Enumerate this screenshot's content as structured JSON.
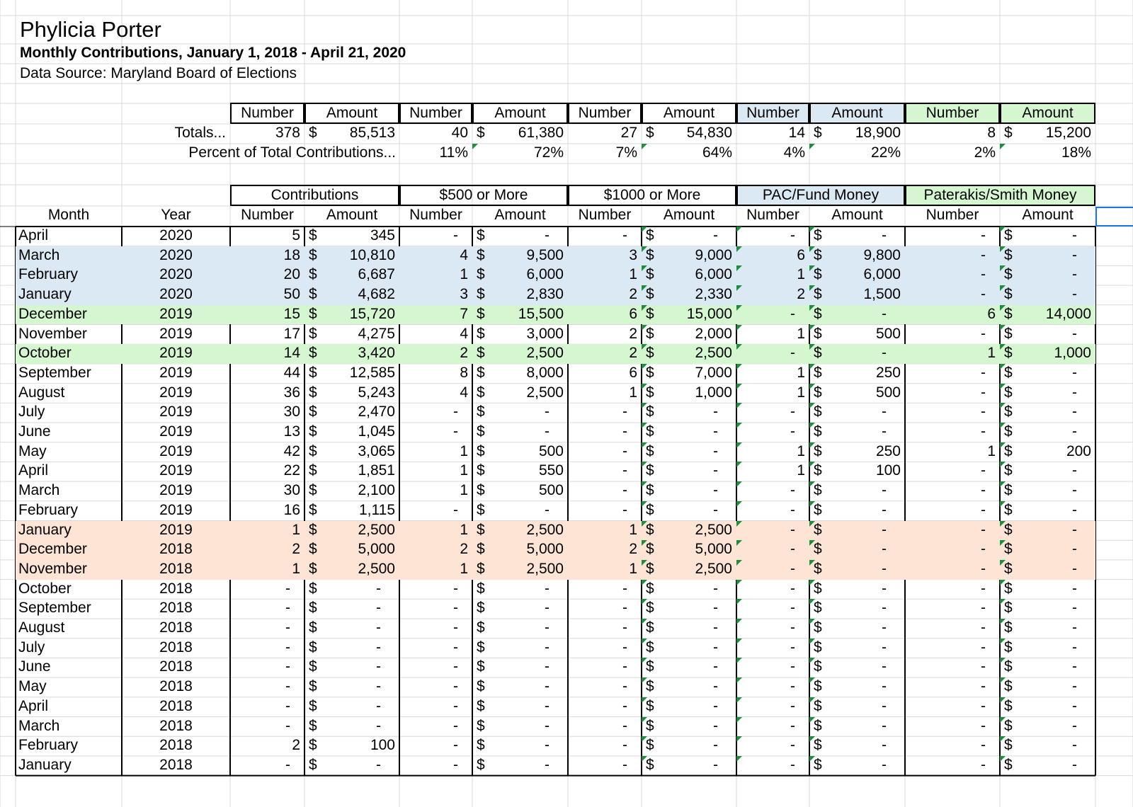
{
  "header": {
    "name": "Phylicia Porter",
    "subtitle": "Monthly Contributions, January 1, 2018 - April 21, 2020",
    "source": "Data Source:  Maryland Board of Elections"
  },
  "colors": {
    "blue": "#dbe9f4",
    "green": "#d4f7d0",
    "peach": "#fde4d4",
    "grid": "#d9d9d9",
    "comment": "#1e8e3e",
    "selection": "#1a73e8"
  },
  "labels": {
    "number": "Number",
    "amount": "Amount",
    "totals": "Totals...",
    "percent": "Percent of Total Contributions...",
    "month": "Month",
    "year": "Year",
    "currency": "$",
    "dash": "-"
  },
  "groups": [
    "Contributions",
    "$500 or More",
    "$1000 or More",
    "PAC/Fund Money",
    "Paterakis/Smith Money"
  ],
  "totals": [
    {
      "number": "378",
      "amount": "85,513"
    },
    {
      "number": "40",
      "amount": "61,380"
    },
    {
      "number": "27",
      "amount": "54,830"
    },
    {
      "number": "14",
      "amount": "18,900"
    },
    {
      "number": "8",
      "amount": "15,200"
    }
  ],
  "percents": [
    {
      "number": "11%",
      "amount": ""
    },
    {
      "number": "",
      "amount": "72%"
    },
    {
      "number": "7%",
      "amount": ""
    },
    {
      "number": "",
      "amount": "64%"
    },
    {
      "number": "4%",
      "amount": ""
    },
    {
      "number": "",
      "amount": "22%"
    },
    {
      "number": "2%",
      "amount": ""
    },
    {
      "number": "",
      "amount": "18%"
    }
  ],
  "percent_values": [
    "11%",
    "72%",
    "7%",
    "64%",
    "4%",
    "22%",
    "2%",
    "18%"
  ],
  "rows": [
    {
      "month": "April",
      "year": "2020",
      "hl": "",
      "v": [
        "5",
        "345",
        "-",
        "-",
        "-",
        "-",
        "-",
        "-",
        "-",
        "-"
      ]
    },
    {
      "month": "March",
      "year": "2020",
      "hl": "blue",
      "v": [
        "18",
        "10,810",
        "4",
        "9,500",
        "3",
        "9,000",
        "6",
        "9,800",
        "-",
        "-"
      ]
    },
    {
      "month": "February",
      "year": "2020",
      "hl": "blue",
      "v": [
        "20",
        "6,687",
        "1",
        "6,000",
        "1",
        "6,000",
        "1",
        "6,000",
        "-",
        "-"
      ]
    },
    {
      "month": "January",
      "year": "2020",
      "hl": "blue",
      "v": [
        "50",
        "4,682",
        "3",
        "2,830",
        "2",
        "2,330",
        "2",
        "1,500",
        "-",
        "-"
      ]
    },
    {
      "month": "December",
      "year": "2019",
      "hl": "green",
      "v": [
        "15",
        "15,720",
        "7",
        "15,500",
        "6",
        "15,000",
        "-",
        "-",
        "6",
        "14,000"
      ]
    },
    {
      "month": "November",
      "year": "2019",
      "hl": "",
      "v": [
        "17",
        "4,275",
        "4",
        "3,000",
        "2",
        "2,000",
        "1",
        "500",
        "-",
        "-"
      ]
    },
    {
      "month": "October",
      "year": "2019",
      "hl": "green",
      "v": [
        "14",
        "3,420",
        "2",
        "2,500",
        "2",
        "2,500",
        "-",
        "-",
        "1",
        "1,000"
      ]
    },
    {
      "month": "September",
      "year": "2019",
      "hl": "",
      "v": [
        "44",
        "12,585",
        "8",
        "8,000",
        "6",
        "7,000",
        "1",
        "250",
        "-",
        "-"
      ]
    },
    {
      "month": "August",
      "year": "2019",
      "hl": "",
      "v": [
        "36",
        "5,243",
        "4",
        "2,500",
        "1",
        "1,000",
        "1",
        "500",
        "-",
        "-"
      ]
    },
    {
      "month": "July",
      "year": "2019",
      "hl": "",
      "v": [
        "30",
        "2,470",
        "-",
        "-",
        "-",
        "-",
        "-",
        "-",
        "-",
        "-"
      ]
    },
    {
      "month": "June",
      "year": "2019",
      "hl": "",
      "v": [
        "13",
        "1,045",
        "-",
        "-",
        "-",
        "-",
        "-",
        "-",
        "-",
        "-"
      ]
    },
    {
      "month": "May",
      "year": "2019",
      "hl": "",
      "v": [
        "42",
        "3,065",
        "1",
        "500",
        "-",
        "-",
        "1",
        "250",
        "1",
        "200"
      ]
    },
    {
      "month": "April",
      "year": "2019",
      "hl": "",
      "v": [
        "22",
        "1,851",
        "1",
        "550",
        "-",
        "-",
        "1",
        "100",
        "-",
        "-"
      ]
    },
    {
      "month": "March",
      "year": "2019",
      "hl": "",
      "v": [
        "30",
        "2,100",
        "1",
        "500",
        "-",
        "-",
        "-",
        "-",
        "-",
        "-"
      ]
    },
    {
      "month": "February",
      "year": "2019",
      "hl": "",
      "v": [
        "16",
        "1,115",
        "-",
        "-",
        "-",
        "-",
        "-",
        "-",
        "-",
        "-"
      ]
    },
    {
      "month": "January",
      "year": "2019",
      "hl": "peach",
      "v": [
        "1",
        "2,500",
        "1",
        "2,500",
        "1",
        "2,500",
        "-",
        "-",
        "-",
        "-"
      ]
    },
    {
      "month": "December",
      "year": "2018",
      "hl": "peach",
      "v": [
        "2",
        "5,000",
        "2",
        "5,000",
        "2",
        "5,000",
        "-",
        "-",
        "-",
        "-"
      ]
    },
    {
      "month": "November",
      "year": "2018",
      "hl": "peach",
      "v": [
        "1",
        "2,500",
        "1",
        "2,500",
        "1",
        "2,500",
        "-",
        "-",
        "-",
        "-"
      ]
    },
    {
      "month": "October",
      "year": "2018",
      "hl": "",
      "v": [
        "-",
        "-",
        "-",
        "-",
        "-",
        "-",
        "-",
        "-",
        "-",
        "-"
      ]
    },
    {
      "month": "September",
      "year": "2018",
      "hl": "",
      "v": [
        "-",
        "-",
        "-",
        "-",
        "-",
        "-",
        "-",
        "-",
        "-",
        "-"
      ]
    },
    {
      "month": "August",
      "year": "2018",
      "hl": "",
      "v": [
        "-",
        "-",
        "-",
        "-",
        "-",
        "-",
        "-",
        "-",
        "-",
        "-"
      ]
    },
    {
      "month": "July",
      "year": "2018",
      "hl": "",
      "v": [
        "-",
        "-",
        "-",
        "-",
        "-",
        "-",
        "-",
        "-",
        "-",
        "-"
      ]
    },
    {
      "month": "June",
      "year": "2018",
      "hl": "",
      "v": [
        "-",
        "-",
        "-",
        "-",
        "-",
        "-",
        "-",
        "-",
        "-",
        "-"
      ]
    },
    {
      "month": "May",
      "year": "2018",
      "hl": "",
      "v": [
        "-",
        "-",
        "-",
        "-",
        "-",
        "-",
        "-",
        "-",
        "-",
        "-"
      ]
    },
    {
      "month": "April",
      "year": "2018",
      "hl": "",
      "v": [
        "-",
        "-",
        "-",
        "-",
        "-",
        "-",
        "-",
        "-",
        "-",
        "-"
      ]
    },
    {
      "month": "March",
      "year": "2018",
      "hl": "",
      "v": [
        "-",
        "-",
        "-",
        "-",
        "-",
        "-",
        "-",
        "-",
        "-",
        "-"
      ]
    },
    {
      "month": "February",
      "year": "2018",
      "hl": "",
      "v": [
        "2",
        "100",
        "-",
        "-",
        "-",
        "-",
        "-",
        "-",
        "-",
        "-"
      ]
    },
    {
      "month": "January",
      "year": "2018",
      "hl": "",
      "v": [
        "-",
        "-",
        "-",
        "-",
        "-",
        "-",
        "-",
        "-",
        "-",
        "-"
      ]
    }
  ]
}
